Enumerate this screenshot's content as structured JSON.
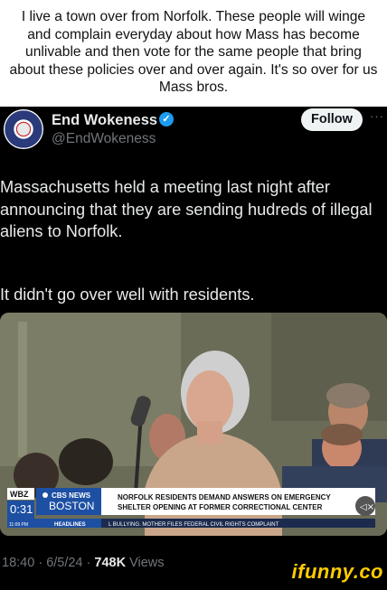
{
  "caption": "I live a town over from Norfolk. These people will winge and complain everyday about how Mass has become unlivable and then vote for the same people that bring about these policies over and over again. It's so over for us Mass bros.",
  "author": {
    "display_name": "End Wokeness",
    "handle": "@EndWokeness",
    "verified": true,
    "avatar_icon": "badge-avatar-icon"
  },
  "follow_label": "Follow",
  "more_label": "···",
  "tweet_text_1": "Massachusetts held a meeting last night after announcing that they are sending hudreds of illegal aliens to Norfolk.",
  "tweet_text_2": "It didn't go over well with residents.",
  "video": {
    "timestamp": "0:31",
    "station_top": "CBS NEWS",
    "station_city": "BOSTON",
    "station_sub": "WBZ",
    "time_label": "11:09 PM",
    "headlines_label": "HEADLINES",
    "headline_1": "NORFOLK RESIDENTS DEMAND ANSWERS ON EMERGENCY",
    "headline_2": "SHELTER OPENING AT FORMER CORRECTIONAL CENTER",
    "ticker": "L BULLYING. MOTHER FILES FEDERAL CIVIL RIGHTS COMPLAINT",
    "mute_icon": "muted-speaker-icon"
  },
  "meta": {
    "time": "18:40",
    "date": "6/5/24",
    "views": "748K",
    "views_label": "Views"
  },
  "watermark": "ifunny.co",
  "colors": {
    "verified_blue": "#1d9bf0",
    "ifunny_yellow": "#ffcc00",
    "cbs_blue": "#1d4fa3"
  }
}
